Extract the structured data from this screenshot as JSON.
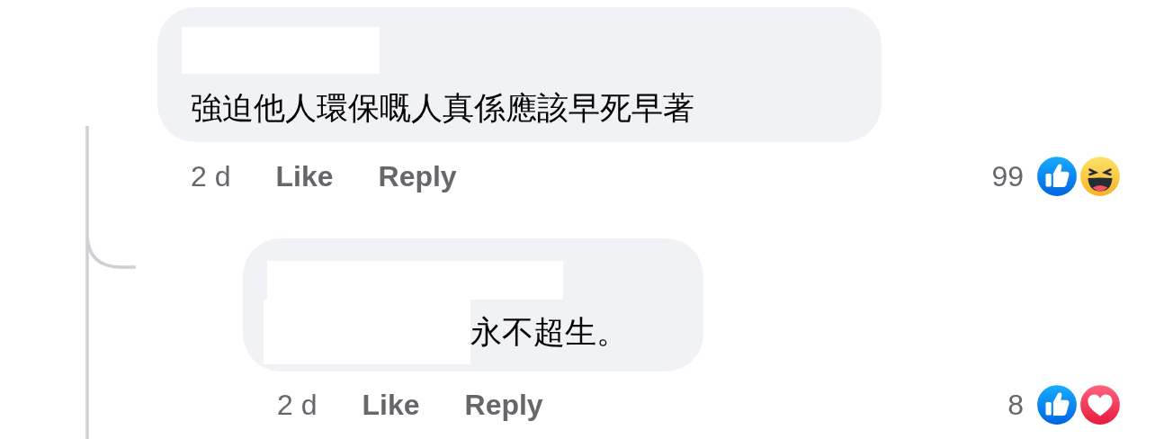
{
  "comments": [
    {
      "text": "強迫他人環保嘅人真係應該早死早著",
      "time": "2 d",
      "actions": [
        "Like",
        "Reply"
      ],
      "reaction_count": "99",
      "reactions": [
        {
          "kind": "like"
        },
        {
          "kind": "haha"
        }
      ],
      "replies": [
        {
          "text": "永不超生。",
          "time": "2 d",
          "actions": [
            "Like",
            "Reply"
          ],
          "reaction_count": "8",
          "reactions": [
            {
              "kind": "like"
            },
            {
              "kind": "love"
            }
          ]
        }
      ]
    }
  ]
}
